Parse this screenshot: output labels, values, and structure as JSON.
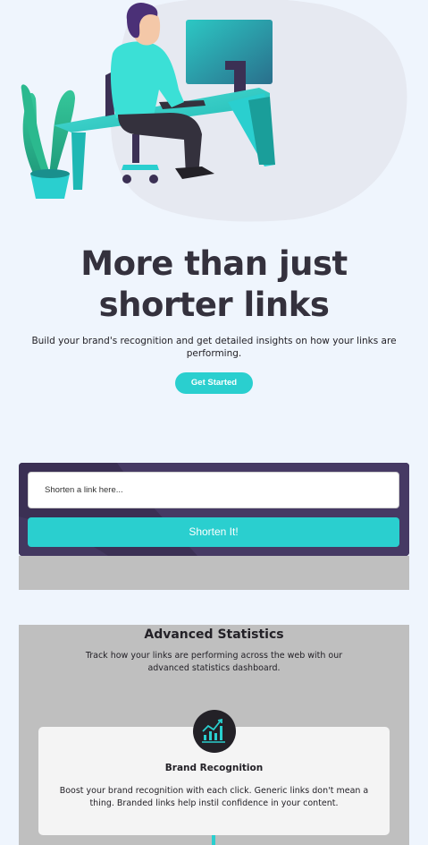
{
  "hero": {
    "title_line1": "More than just",
    "title_line2": "shorter links",
    "subtitle": "Build your brand's recognition and get detailed insights on how your links are performing.",
    "cta_label": "Get Started"
  },
  "shorten": {
    "placeholder": "Shorten a link here...",
    "button_label": "Shorten It!"
  },
  "statistics": {
    "title": "Advanced Statistics",
    "subtitle": "Track how your links are performing across the web with our advanced statistics dashboard.",
    "cards": [
      {
        "icon": "brand-recognition-icon",
        "title": "Brand Recognition",
        "text": "Boost your brand recognition with each click. Generic links don't mean a thing. Branded links help instil confidence in your content."
      }
    ]
  },
  "colors": {
    "accent": "#2acfcf",
    "dark_violet": "#3b3054",
    "very_dark": "#232127",
    "background": "#eff5fd"
  }
}
